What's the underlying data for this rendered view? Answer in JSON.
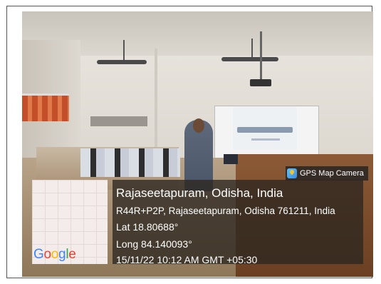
{
  "badge": {
    "text": "GPS Map Camera",
    "icon": "gps-map-camera-icon"
  },
  "location": {
    "title": "Rajaseetapuram, Odisha, India",
    "address": "R44R+P2P, Rajaseetapuram, Odisha 761211, India",
    "lat": "Lat 18.80688°",
    "long": "Long 84.140093°",
    "datetime": "15/11/22 10:12 AM GMT +05:30"
  },
  "map": {
    "logo_text": "Google"
  }
}
